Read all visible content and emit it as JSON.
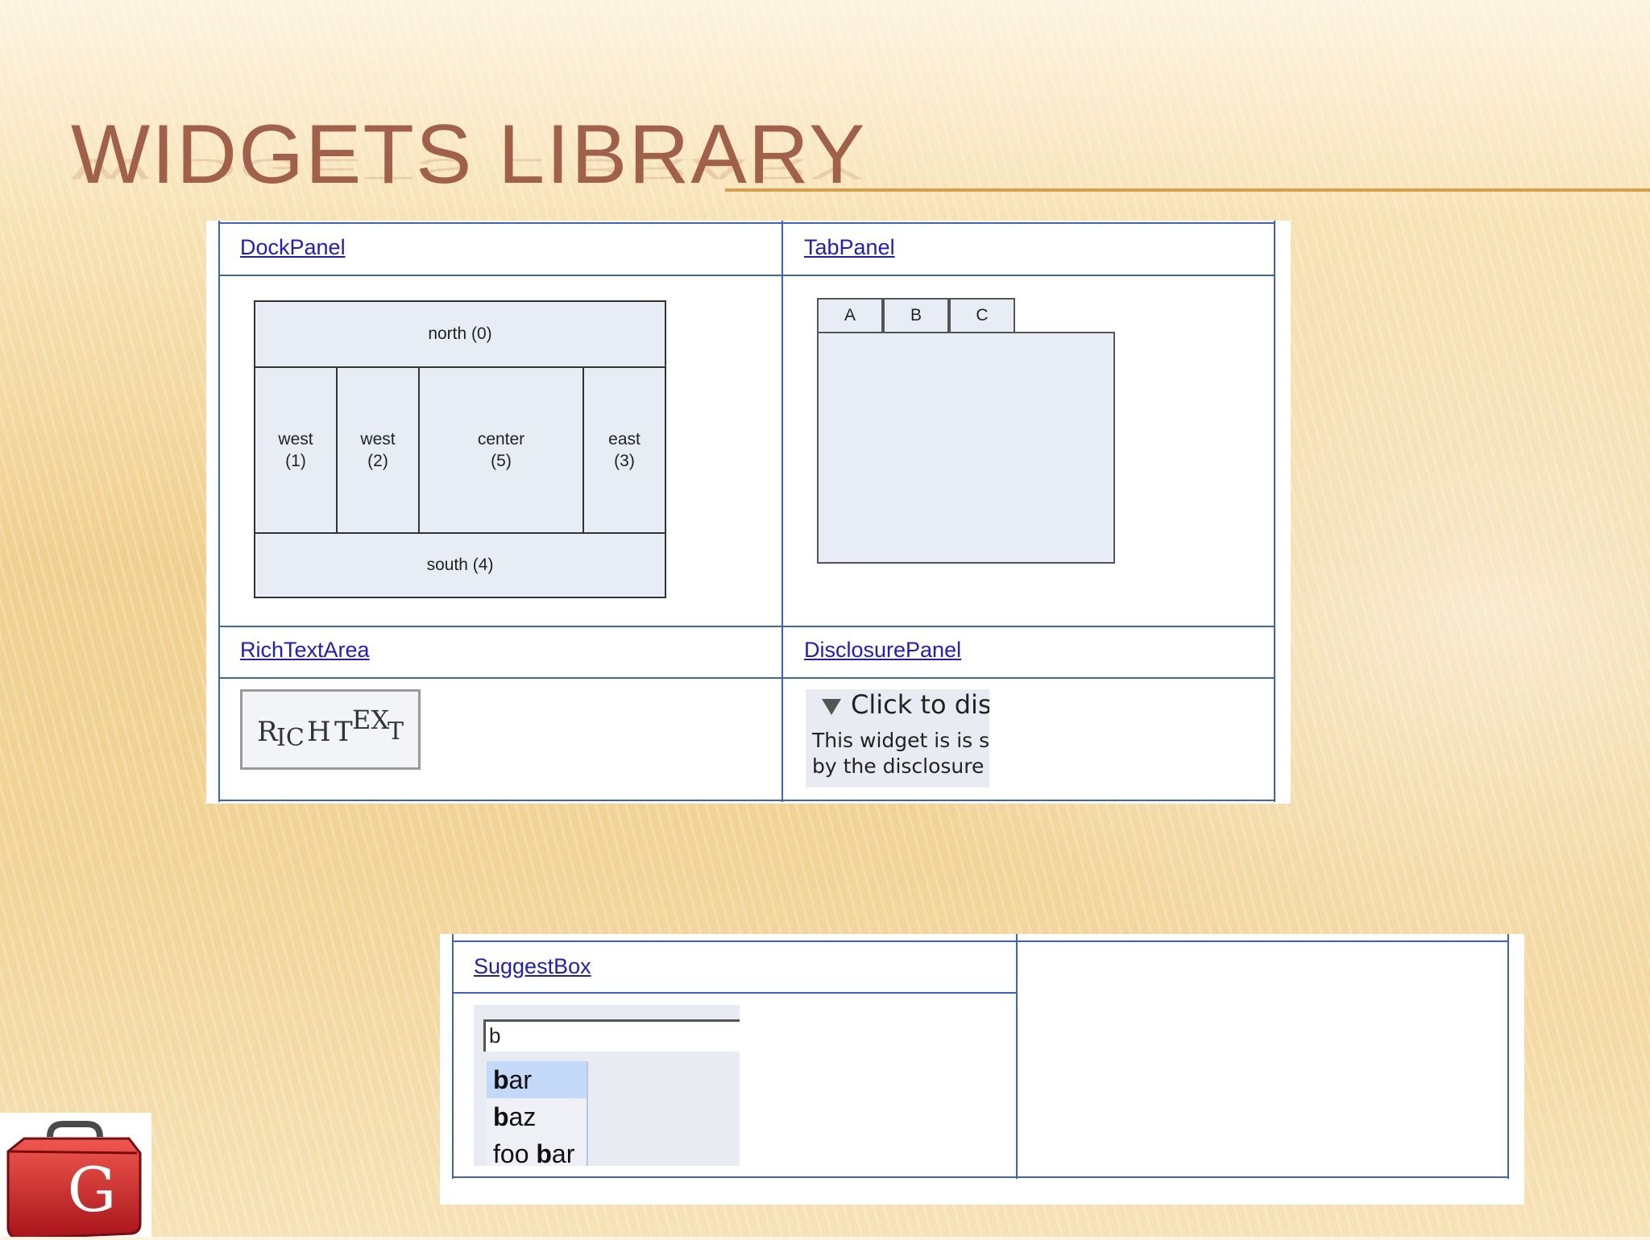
{
  "slide": {
    "title": "WIDGETS LIBRARY"
  },
  "table1": {
    "dock_label": "DockPanel",
    "tab_label": "TabPanel",
    "rich_label": "RichTextArea",
    "disclosure_label": "DisclosurePanel"
  },
  "dock": {
    "north": "north (0)",
    "west1_a": "west",
    "west1_b": "(1)",
    "west2_a": "west",
    "west2_b": "(2)",
    "center_a": "center",
    "center_b": "(5)",
    "east_a": "east",
    "east_b": "(3)",
    "south": "south (4)"
  },
  "tabs": [
    "A",
    "B",
    "C"
  ],
  "richtext": {
    "r": "R",
    "ic": "IC",
    "h": "H",
    "t": "T",
    "ex": "EX",
    "t2": "T"
  },
  "disclosure": {
    "header": "Click to dis",
    "line1": "This widget is is s",
    "line2": "by the disclosure"
  },
  "table2": {
    "suggest_label": "SuggestBox"
  },
  "suggest": {
    "input_value": "b",
    "items": [
      {
        "bold": "b",
        "rest": "ar"
      },
      {
        "bold": "b",
        "rest": "az"
      },
      {
        "pre": "foo ",
        "bold": "b",
        "rest": "ar"
      }
    ]
  },
  "colors": {
    "title": "#a0604a",
    "grid": "#3a62c8",
    "link": "#1e1ebe",
    "logo": "#d0302a"
  },
  "icons": {
    "logo": "gwt-toolbox-logo-icon",
    "disclosure": "triangle-down-icon"
  }
}
